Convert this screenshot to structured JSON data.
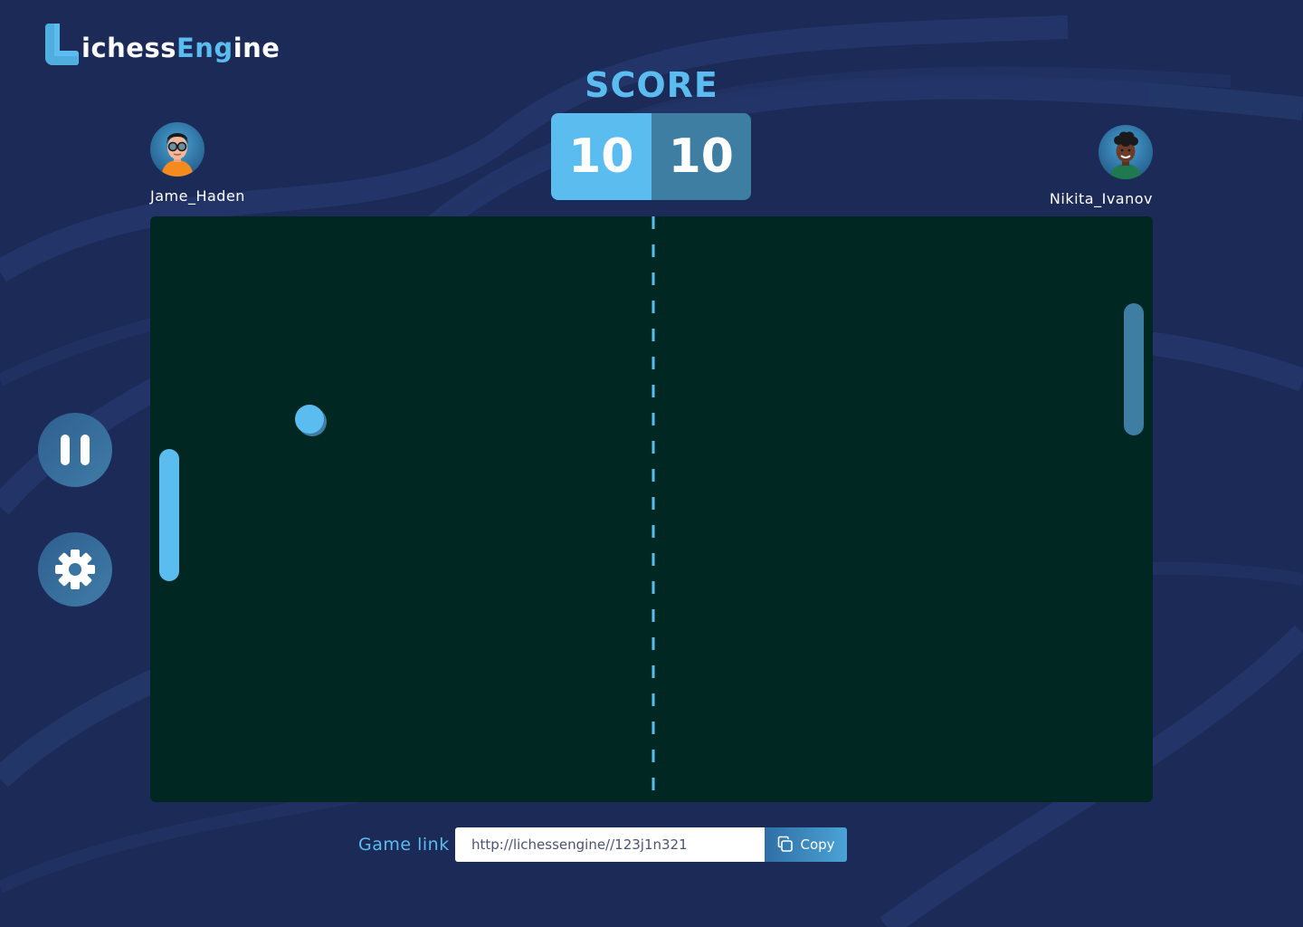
{
  "brand": {
    "name_part1": "ichess",
    "name_part2": "Eng",
    "name_part3": "ine",
    "accent_color": "#5bbcf0"
  },
  "score": {
    "title": "SCORE",
    "left": "10",
    "right": "10"
  },
  "players": {
    "left": {
      "name": "Jame_Haden",
      "avatar_icon": "avatar-glasses-orange-shirt"
    },
    "right": {
      "name": "Nikita_Ivanov",
      "avatar_icon": "avatar-curly-hair-green-shirt"
    }
  },
  "controls": {
    "pause_icon": "pause-icon",
    "settings_icon": "gear-icon"
  },
  "game_link": {
    "label": "Game link",
    "value": "http://lichessengine//123j1n321",
    "copy_label": "Copy",
    "copy_icon": "copy-icon"
  },
  "colors": {
    "background": "#1b2a57",
    "field": "#002722",
    "accent": "#5bbcf0",
    "accent_dark": "#3e7ea3"
  }
}
